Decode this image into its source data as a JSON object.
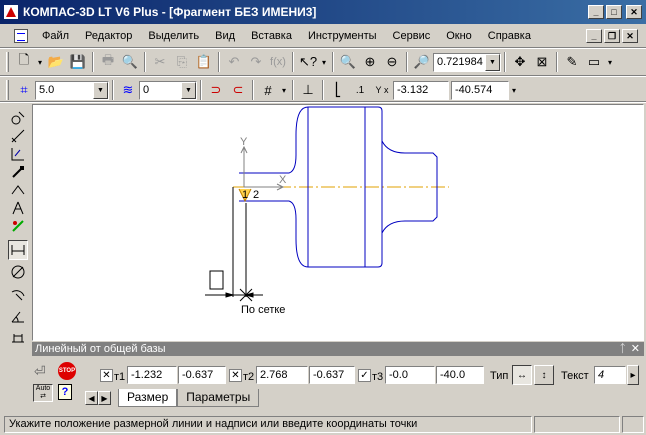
{
  "window": {
    "title": "КОМПАС-3D LT V6 Plus - [Фрагмент БЕЗ ИМЕНИ3]"
  },
  "menu": [
    {
      "label": "Файл"
    },
    {
      "label": "Редактор"
    },
    {
      "label": "Выделить"
    },
    {
      "label": "Вид"
    },
    {
      "label": "Вставка"
    },
    {
      "label": "Инструменты"
    },
    {
      "label": "Сервис"
    },
    {
      "label": "Окно"
    },
    {
      "label": "Справка"
    }
  ],
  "toolbar": {
    "zoom_value": "0.721984"
  },
  "toolbar2": {
    "step_value": "5.0",
    "layer_value": "0",
    "coord_x": "-3.132",
    "coord_y": "-40.574",
    "coord_label": "Y x"
  },
  "canvas": {
    "axis_y_label": "Y",
    "axis_x_label": "X",
    "point_label_1": "1",
    "point_label_2": "2",
    "cursor_hint": "По сетке"
  },
  "panel": {
    "title": "Линейный от общей базы",
    "t1_label": "т1",
    "t1_x": "-1.232",
    "t1_y": "-0.637",
    "t2_label": "т2",
    "t2_x": "2.768",
    "t2_y": "-0.637",
    "t3_label": "т3",
    "t3_x": "-0.0",
    "t3_y": "-40.0",
    "type_label": "Тип",
    "text_label": "Текст",
    "text_value": "4",
    "auto_label": "Auto",
    "tabs": [
      {
        "label": "Размер"
      },
      {
        "label": "Параметры"
      }
    ]
  },
  "status": {
    "hint": "Укажите положение размерной линии и надписи или введите координаты точки"
  },
  "colors": {
    "title_start": "#0a246a",
    "title_end": "#3a6ea5",
    "drawing": "#0000c0",
    "axis": "#e0a000"
  }
}
